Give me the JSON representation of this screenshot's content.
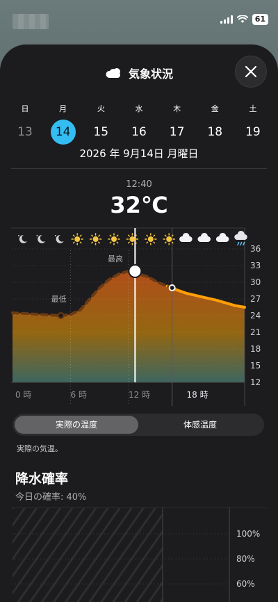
{
  "status": {
    "battery": "61"
  },
  "header": {
    "title": "気象状況"
  },
  "week": {
    "weekdays": [
      "日",
      "月",
      "火",
      "水",
      "木",
      "金",
      "土"
    ],
    "days": [
      "13",
      "14",
      "15",
      "16",
      "17",
      "18",
      "19"
    ],
    "selected_index": 1
  },
  "date_title": "2026 年 9月14日 月曜日",
  "current": {
    "time": "12:40",
    "temp": "32℃"
  },
  "conditions": [
    "moon",
    "moon",
    "moon",
    "sun",
    "sun",
    "sun",
    "sun",
    "sun",
    "sun",
    "cloud",
    "cloud",
    "cloud",
    "rain"
  ],
  "chart_data": {
    "type": "line",
    "x": [
      0,
      1,
      2,
      3,
      4,
      5,
      6,
      7,
      8,
      9,
      10,
      11,
      12,
      13,
      14,
      15,
      16,
      17,
      18,
      19,
      20,
      21,
      22,
      23
    ],
    "series": [
      {
        "values": [
          24.5,
          24.4,
          24.3,
          24.2,
          24.1,
          24.0,
          24.2,
          25.0,
          27.0,
          29.0,
          30.5,
          31.5,
          32.0,
          31.5,
          31.0,
          30.0,
          29.3,
          28.6,
          28.0,
          27.6,
          27.2,
          26.8,
          26.3,
          25.8
        ]
      }
    ],
    "ylim": [
      12,
      36
    ],
    "yticks": [
      "36",
      "33",
      "30",
      "27",
      "24",
      "21",
      "18",
      "15",
      "12"
    ],
    "xticks": [
      "0 時",
      "6 時",
      "12 時",
      "18 時"
    ],
    "annotations": {
      "low_label": "最低",
      "high_label": "最高"
    },
    "current_hour": 12.67,
    "forecast_start_hour": 16.5
  },
  "toggle": {
    "actual": "実際の温度",
    "feels": "体感温度"
  },
  "caption": "実際の気温。",
  "precip": {
    "title": "降水確率",
    "subtitle": "今日の確率: 40%",
    "yticks": [
      "100%",
      "80%",
      "60%"
    ]
  }
}
